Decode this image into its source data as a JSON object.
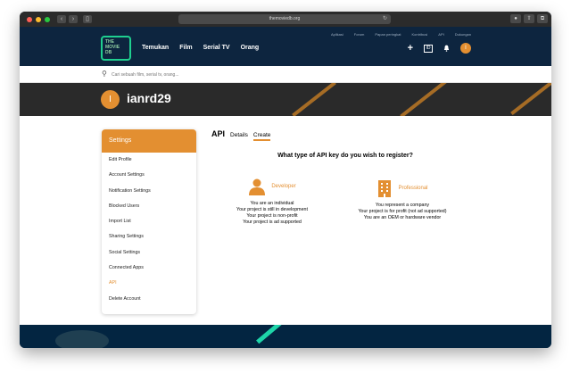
{
  "browser": {
    "url": "themoviedb.org",
    "back_glyph": "‹",
    "forward_glyph": "›",
    "sidebar_glyph": "▯",
    "reload_glyph": "↻",
    "extension_glyph": "●",
    "share_glyph": "⇧",
    "tabs_glyph": "⧉"
  },
  "header": {
    "logo_lines": [
      "THE",
      "MOVIE",
      "DB"
    ],
    "menu": [
      "Temukan",
      "Film",
      "Serial TV",
      "Orang"
    ],
    "top_links": [
      "Aplikasi",
      "Forum",
      "Papan peringkat",
      "Kontribusi",
      "API",
      "Dukungan"
    ],
    "plus_glyph": "+",
    "tv_label": "ID",
    "user_initial": "I"
  },
  "search": {
    "icon": "search-icon",
    "glyph": "⚲",
    "placeholder": "Cari sebuah film, serial tv, orang..."
  },
  "profile": {
    "initial": "I",
    "username": "ianrd29"
  },
  "sidebar": {
    "title": "Settings",
    "items": [
      {
        "label": "Edit Profile"
      },
      {
        "label": "Account Settings"
      },
      {
        "label": "Notification Settings"
      },
      {
        "label": "Blocked Users"
      },
      {
        "label": "Import List"
      },
      {
        "label": "Sharing Settings"
      },
      {
        "label": "Social Settings"
      },
      {
        "label": "Connected Apps"
      },
      {
        "label": "API"
      },
      {
        "label": "Delete Account"
      }
    ]
  },
  "api_page": {
    "tab_title": "API",
    "tabs": [
      "Details",
      "Create"
    ],
    "question": "What type of API key do you wish to register?",
    "developer": {
      "title": "Developer",
      "lines": [
        "You are an individual",
        "Your project is still in development",
        "Your project is non-profit",
        "Your project is ad supported"
      ]
    },
    "professional": {
      "title": "Professional",
      "lines": [
        "You represent a company",
        "Your project is for profit (not ad supported)",
        "You are an OEM or hardware vendor"
      ]
    }
  },
  "colors": {
    "accent": "#e38f31",
    "header_bg": "#0d253f",
    "logo_green": "#1fcf8f"
  }
}
